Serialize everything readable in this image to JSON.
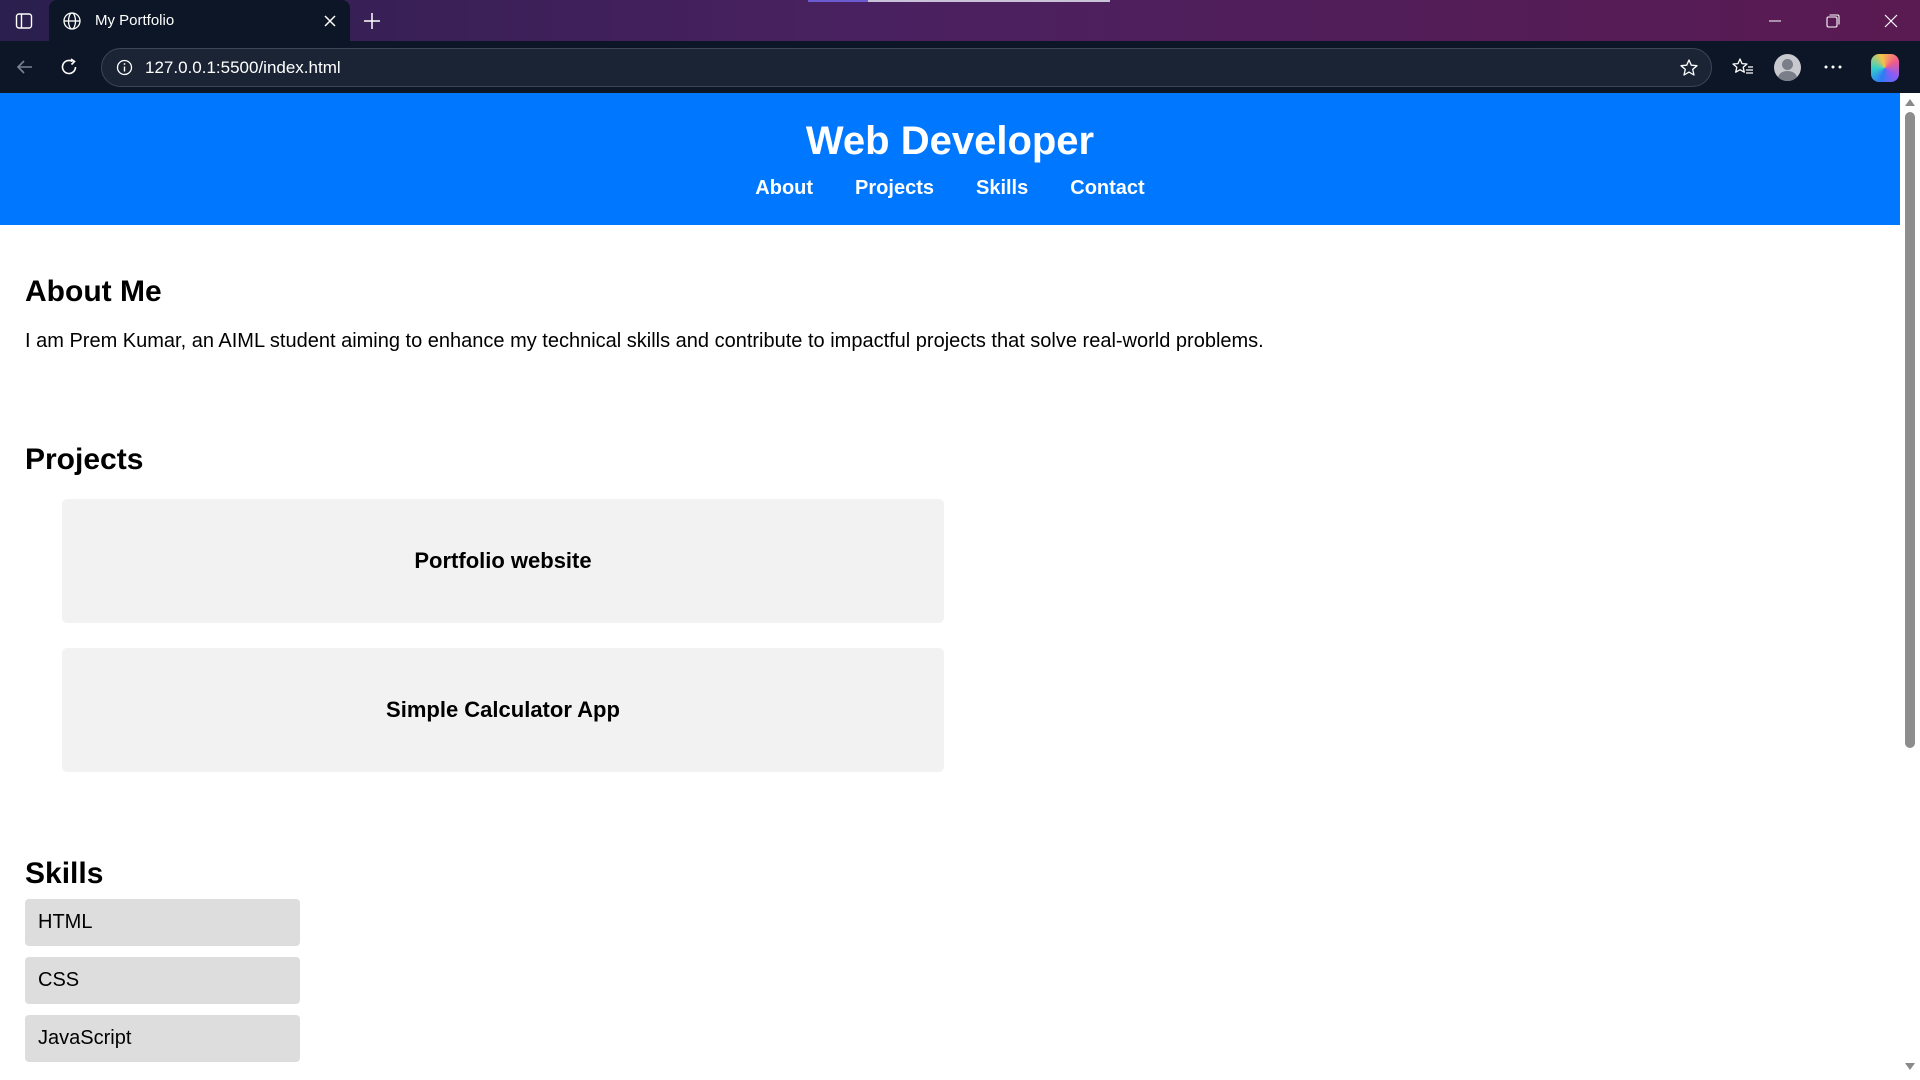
{
  "browser": {
    "tab_title": "My Portfolio",
    "url": "127.0.0.1:5500/index.html"
  },
  "site": {
    "title": "Web Developer",
    "nav": [
      {
        "label": "About"
      },
      {
        "label": "Projects"
      },
      {
        "label": "Skills"
      },
      {
        "label": "Contact"
      }
    ],
    "about": {
      "heading": "About Me",
      "text": "I am Prem Kumar, an AIML student aiming to enhance my technical skills and contribute to impactful projects that solve real-world problems."
    },
    "projects": {
      "heading": "Projects",
      "items": [
        {
          "title": "Portfolio website"
        },
        {
          "title": "Simple Calculator App"
        }
      ]
    },
    "skills": {
      "heading": "Skills",
      "items": [
        {
          "name": "HTML"
        },
        {
          "name": "CSS"
        },
        {
          "name": "JavaScript"
        }
      ]
    }
  },
  "colors": {
    "header_bg": "#0077ff",
    "card_bg": "#f2f2f2",
    "skill_bg": "#dddddd",
    "chrome_bg": "#0c1626"
  },
  "icons": [
    "sidebar-toggle-icon",
    "globe-icon",
    "close-icon",
    "plus-icon",
    "minimize-icon",
    "restore-icon",
    "back-icon",
    "reload-icon",
    "info-icon",
    "star-icon",
    "favorites-icon",
    "more-icon",
    "copilot-icon"
  ]
}
